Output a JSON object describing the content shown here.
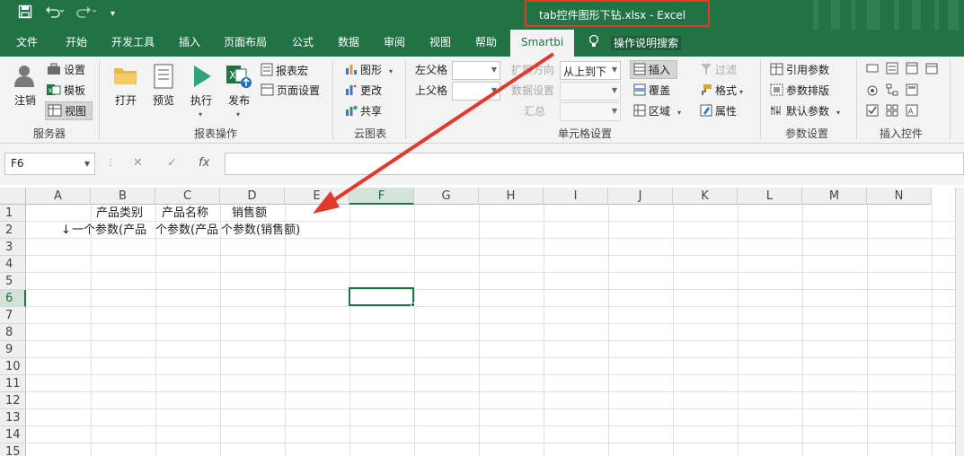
{
  "window": {
    "title": "tab控件图形下钻.xlsx  -  Excel",
    "accent": "#217346",
    "highlight_color": "#e03a2b"
  },
  "quick_access": {
    "save_icon": "save-icon",
    "undo_icon": "undo-icon",
    "redo_icon": "redo-icon",
    "customize_icon": "chevron-down-icon"
  },
  "tabs": [
    "文件",
    "开始",
    "开发工具",
    "插入",
    "页面布局",
    "公式",
    "数据",
    "审阅",
    "视图",
    "帮助",
    "Smartbi"
  ],
  "active_tab": "Smartbi",
  "search": {
    "placeholder": "操作说明搜索"
  },
  "ribbon": {
    "server": {
      "label": "服务器",
      "logout": "注销",
      "settings": "设置",
      "template": "模板",
      "view": "视图"
    },
    "report_ops": {
      "label": "报表操作",
      "open": "打开",
      "preview": "预览",
      "execute": "执行",
      "publish": "发布",
      "macro": "报表宏",
      "page_setup": "页面设置"
    },
    "cloud_chart": {
      "label": "云图表",
      "chart": "图形",
      "change": "更改",
      "share": "共享"
    },
    "cell_settings": {
      "label": "单元格设置",
      "left_parent": "左父格",
      "top_parent": "上父格",
      "expand_direction": "扩展方向",
      "expand_value": "从上到下",
      "data_setting": "数据设置",
      "summary": "汇总",
      "insert": "插入",
      "cover": "覆盖",
      "area": "区域",
      "filter": "过滤",
      "format": "格式",
      "property": "属性"
    },
    "param_settings": {
      "label": "参数设置",
      "ref_param": "引用参数",
      "param_layout": "参数排版",
      "default_param": "默认参数"
    },
    "insert_control": {
      "label": "插入控件"
    }
  },
  "formula_bar": {
    "name_box": "F6",
    "cancel_icon": "cancel-icon",
    "confirm_icon": "check-icon",
    "fx": "fx",
    "value": ""
  },
  "columns": [
    "A",
    "B",
    "C",
    "D",
    "E",
    "F",
    "G",
    "H",
    "I",
    "J",
    "K",
    "L",
    "M",
    "N"
  ],
  "rows": [
    "1",
    "2",
    "3",
    "4",
    "5",
    "6",
    "7",
    "8",
    "9",
    "10",
    "11",
    "12",
    "13",
    "14",
    "15"
  ],
  "selected_column": "F",
  "selected_row": "6",
  "cells": {
    "B1": "产品类别",
    "C1": "产品名称",
    "D1": "销售额",
    "A2_marker": "↓",
    "B2": "一个参数(产品",
    "C2": "个参数(产品",
    "D2": "个参数(销售额)"
  }
}
